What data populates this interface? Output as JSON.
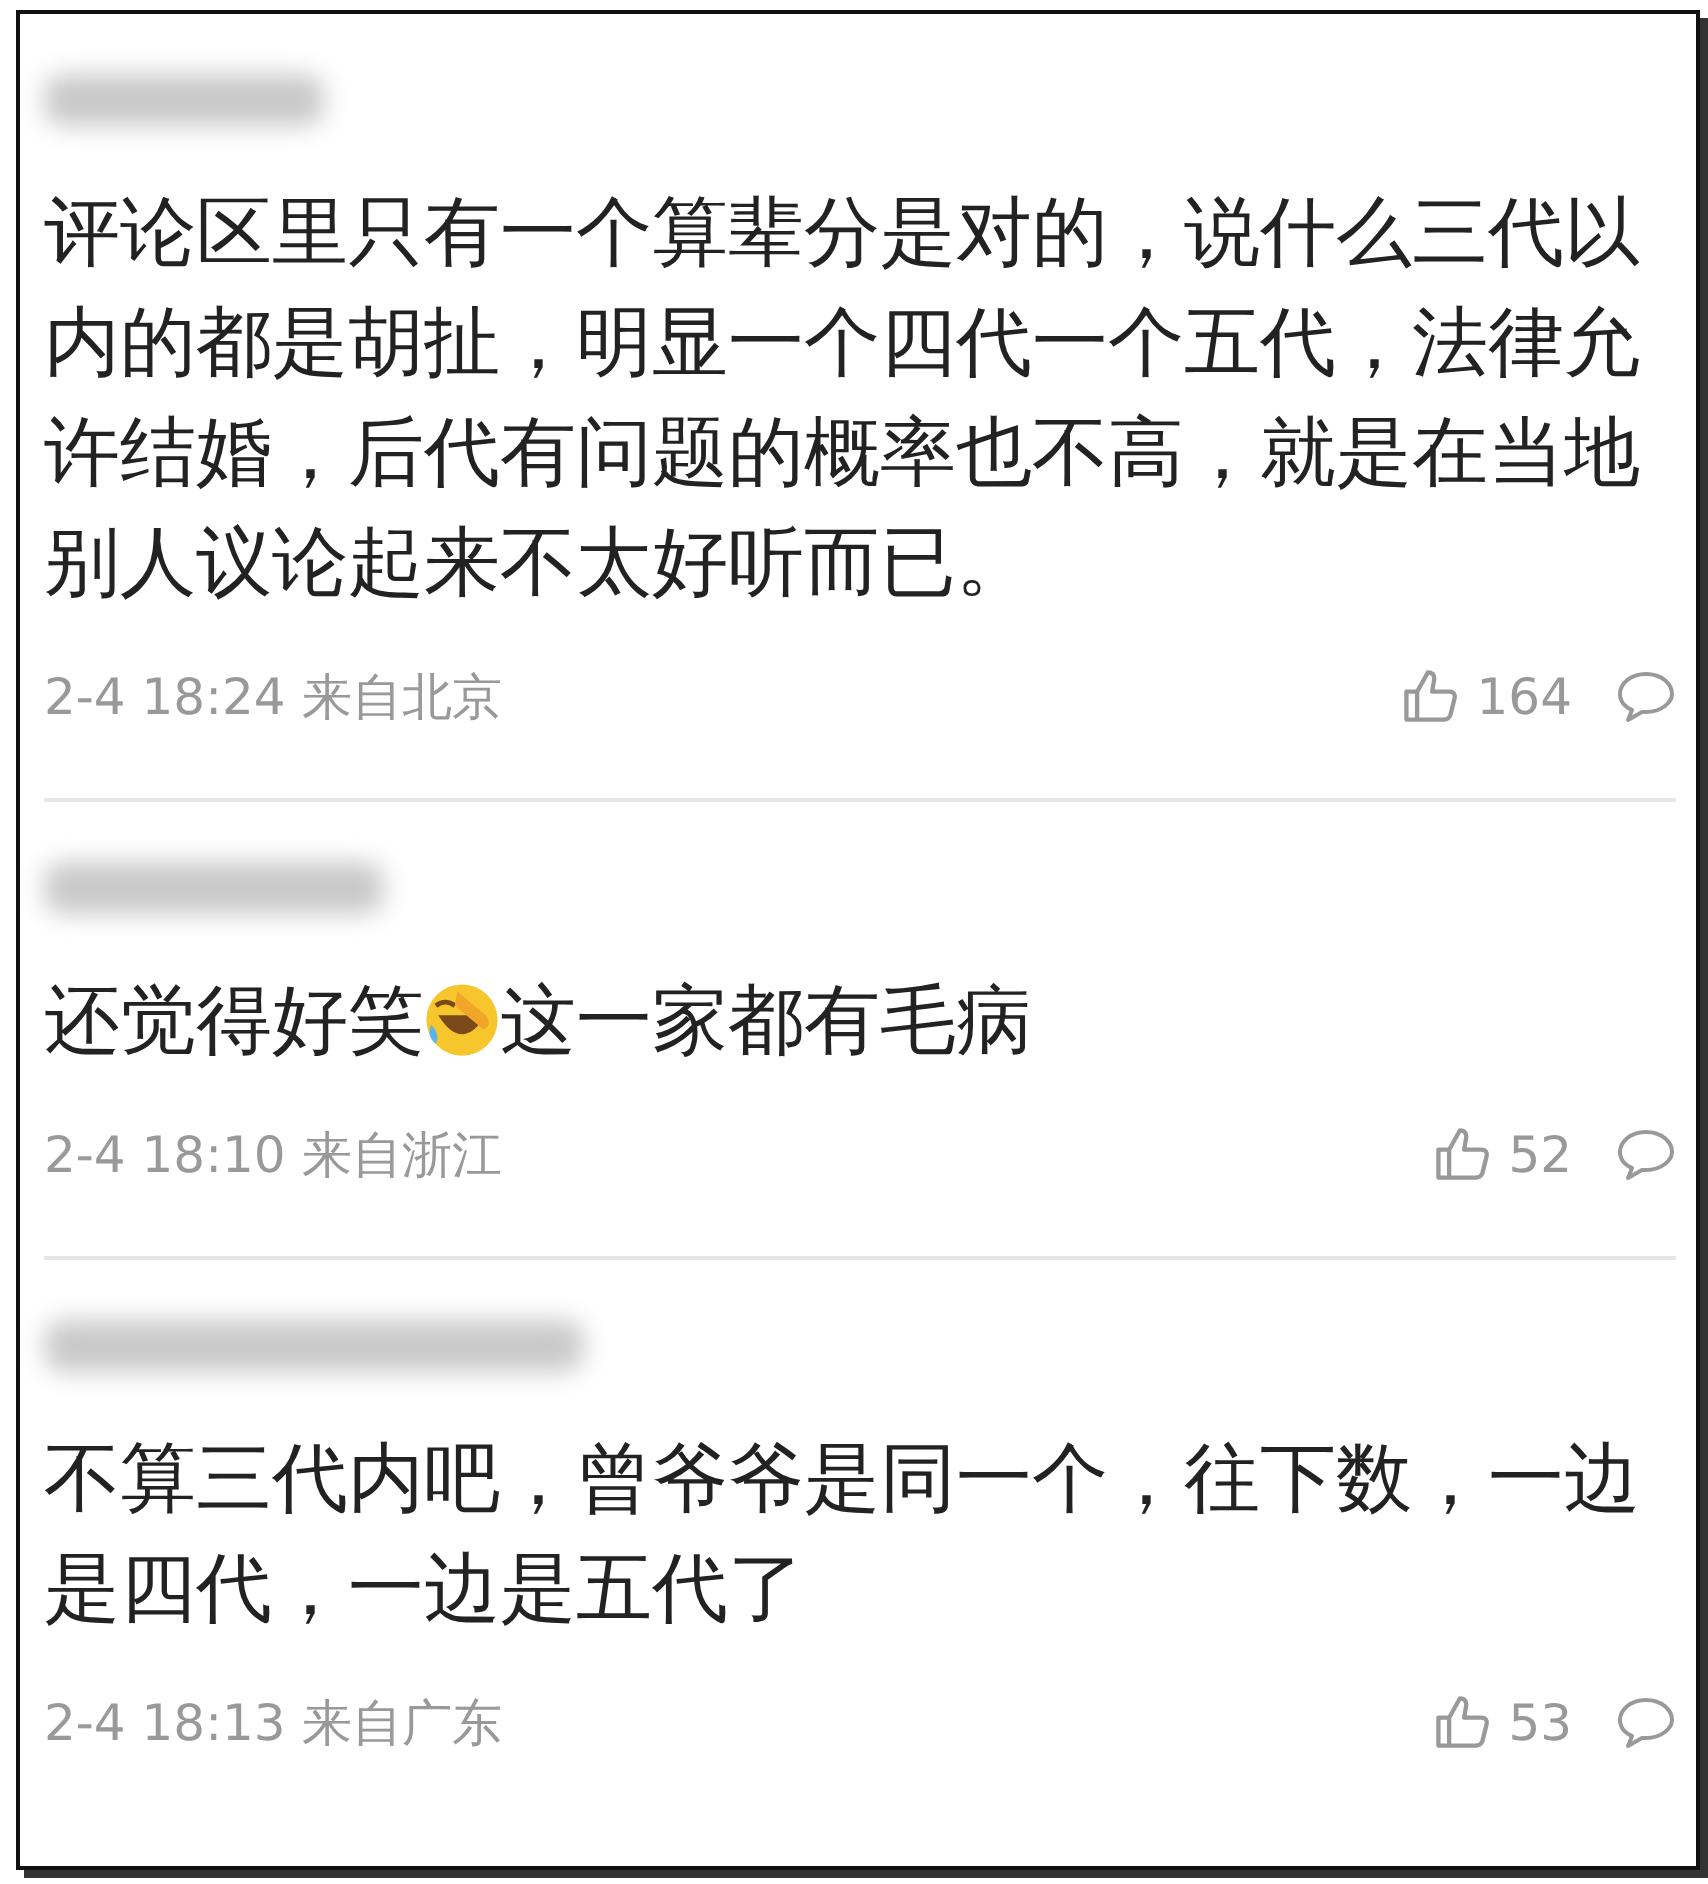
{
  "comments": [
    {
      "body": [
        {
          "kind": "text",
          "text": "评论区里只有一个算辈分是对的，说什么三代以内的都是胡扯，明显一个四代一个五代，法律允许结婚，后代有问题的概率也不高，就是在当地别人议论起来不太好听而已。"
        }
      ],
      "meta": "2-4 18:24 来自北京",
      "likes": "164"
    },
    {
      "body": [
        {
          "kind": "text",
          "text": "还觉得好笑"
        },
        {
          "kind": "emoji"
        },
        {
          "kind": "text",
          "text": "这一家都有毛病"
        }
      ],
      "meta": "2-4 18:10 来自浙江",
      "likes": "52"
    },
    {
      "body": [
        {
          "kind": "text",
          "text": "不算三代内吧，曾爷爷是同一个，往下数，一边是四代，一边是五代了"
        }
      ],
      "meta": "2-4 18:13 来自广东",
      "likes": "53"
    }
  ]
}
